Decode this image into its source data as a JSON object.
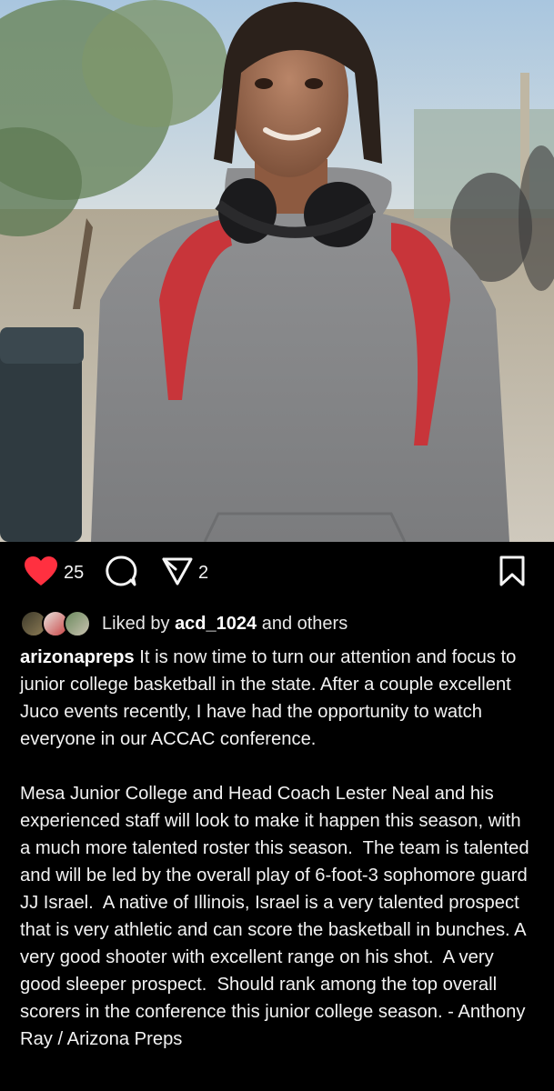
{
  "post": {
    "image_alt": "Smiling young man with headphones around his neck and a red backpack",
    "likes_count": "25",
    "shares_count": "2",
    "liked_by_prefix": "Liked by ",
    "liked_by_user": "acd_1024",
    "liked_by_suffix": " and others",
    "caption_user": "arizonapreps",
    "caption_p1": " It is now time to turn our attention and focus to junior college basketball in the state. After a couple excellent Juco events recently, I have had the opportunity to watch everyone in our ACCAC conference.",
    "caption_p2": "Mesa Junior College and Head Coach Lester Neal and his experienced staff will look to make it happen this season, with a much more talented roster this season.  The team is talented and will be led by the overall play of 6-foot-3 sophomore guard JJ Israel.  A native of Illinois, Israel is a very talented prospect that is very athletic and can score the basketball in bunches. A very good shooter with excellent range on his shot.  A very good sleeper prospect.  Should rank among the top overall scorers in the conference this junior college season. - Anthony Ray / Arizona Preps"
  },
  "icons": {
    "like": "heart-icon",
    "comment": "comment-icon",
    "share": "share-icon",
    "save": "bookmark-icon"
  },
  "colors": {
    "like_red": "#ff3040",
    "background": "#000000",
    "text": "#f5f5f5"
  }
}
